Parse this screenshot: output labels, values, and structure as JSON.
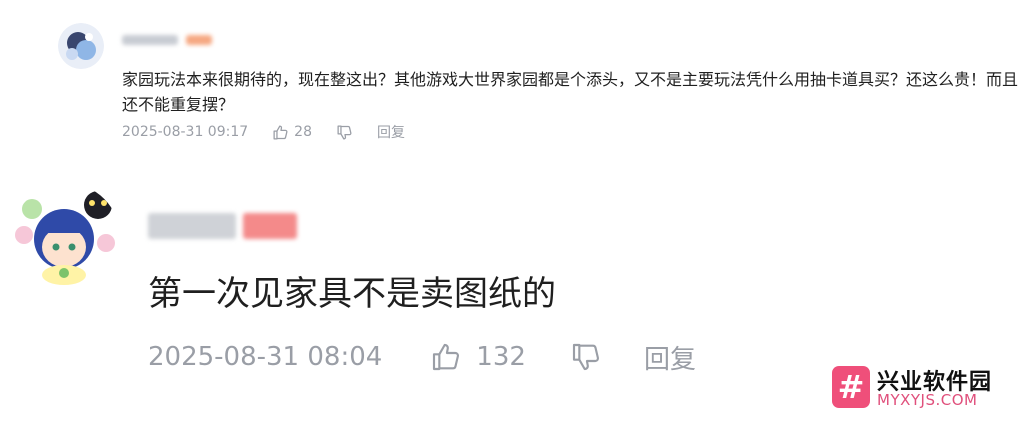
{
  "comments": [
    {
      "text": "家园玩法本来很期待的，现在整这出？其他游戏大世界家园都是个添头，又不是主要玩法凭什么用抽卡道具买？还这么贵！而且还不能重复摆？",
      "time": "2025-08-31 09:17",
      "likes": "28",
      "reply_label": "回复"
    },
    {
      "text": "第一次见家具不是卖图纸的",
      "time": "2025-08-31 08:04",
      "likes": "132",
      "reply_label": "回复"
    }
  ],
  "watermark": {
    "logo_symbol": "#",
    "title": "兴业软件园",
    "url": "MYXYJS.COM"
  },
  "colors": {
    "meta_gray": "#9a9ea6",
    "watermark_pink": "#ef4f7a"
  },
  "icons": [
    "thumbs-up-icon",
    "thumbs-down-icon"
  ]
}
